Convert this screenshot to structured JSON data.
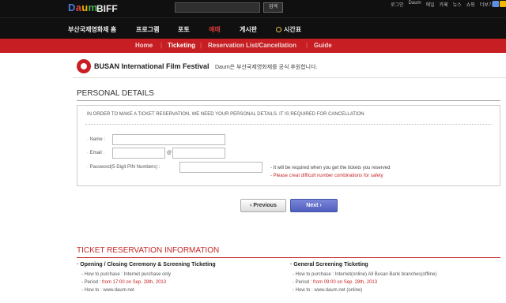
{
  "header": {
    "logo": {
      "d1": "D",
      "d2": "a",
      "d3": "u",
      "d4": "m"
    },
    "site_name": "BIFF",
    "search": {
      "placeholder": "",
      "button": "검색"
    },
    "util_links": [
      "로그인",
      "Daum",
      "메일",
      "카페",
      "뉴스",
      "쇼핑",
      "더보기 ▾"
    ]
  },
  "nav": {
    "items": [
      "부산국제영화제 홈",
      "프로그램",
      "포토",
      "예매",
      "게시판",
      "시간표"
    ],
    "active_index": 3
  },
  "subnav": {
    "items": [
      "Home",
      "Ticketing",
      "Reservation List/Cancellation",
      "Guide"
    ],
    "active_index": 1
  },
  "banner": {
    "festival": "BUSAN International Film Festival",
    "sponsor": "Daum은 부산국제영화제를 공식 후원합니다."
  },
  "personal": {
    "title": "PERSONAL DETAILS",
    "notice": "IN ORDER TO MAKE A TICKET RESERVATION, WE NEED YOUR PERSONAL DETAILS. IT IS REQUIRED FOR CANCELLATION",
    "name_label": "· Name :",
    "email_label": "· Email :",
    "at": "@",
    "password_label": "· Password(5-Digit PIN Numbers) :",
    "hint": "- It will be required when you get the tickets you reserved",
    "warn": "- Please creat difficult number combinations for safety"
  },
  "buttons": {
    "prev": "‹ Previous",
    "next": "Next ›"
  },
  "info": {
    "title": "TICKET RESERVATION INFORMATION",
    "col1": {
      "title": "· Opening / Closing Ceremony & Screening Ticketing",
      "how_label": "- How to purchase : ",
      "how_value": "Internet purchase only",
      "period_label": "- Period : ",
      "period_value": "from 17:00 on Sep. 28th, 2013",
      "howto_label": "- How to : ",
      "howto_value": "www.daum.net"
    },
    "col2": {
      "title": "· General Screening Ticketing",
      "how_label": "- How to purchase : ",
      "how_value": "Internet(online) All Busan Bank branches(offline)",
      "period_label": "- Period : ",
      "period_value": "from 09:00 on Sep. 28th, 2013",
      "howto_label": "- How to : ",
      "howto_value": "www.daum.net (online)"
    }
  },
  "colors": {
    "brand_red": "#c61e22",
    "accent_blue": "#505fbe"
  }
}
